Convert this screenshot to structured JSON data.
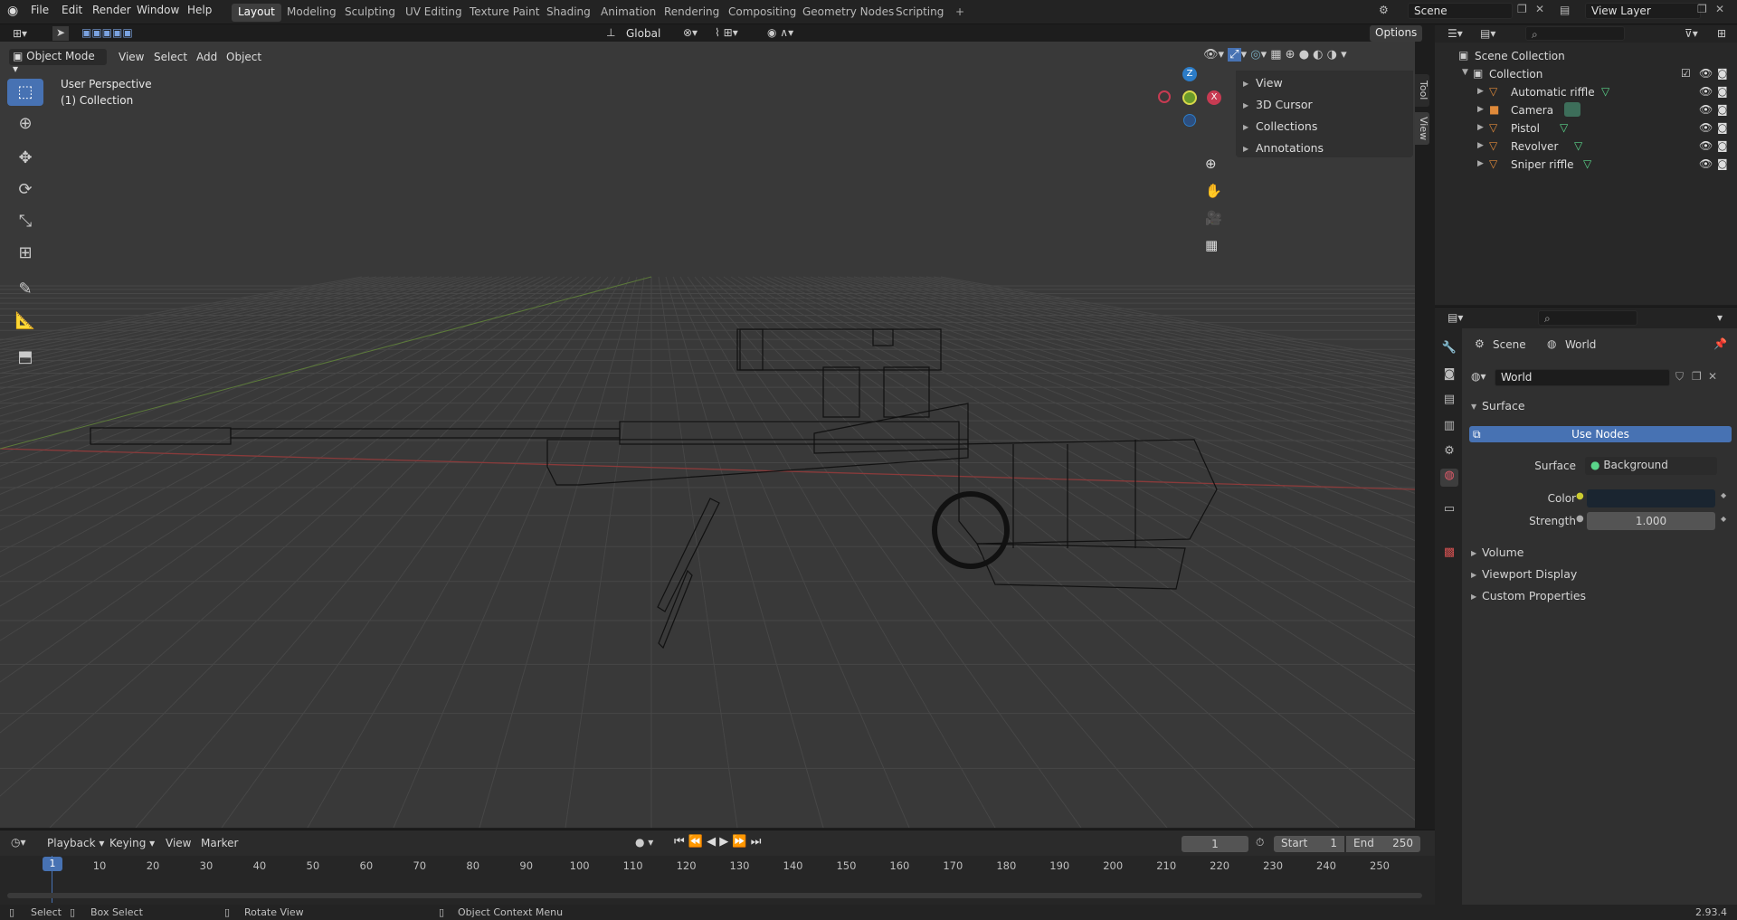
{
  "app": {
    "version": "2.93.4"
  },
  "topbar": {
    "menus": [
      "File",
      "Edit",
      "Render",
      "Window",
      "Help"
    ],
    "workspaces": [
      "Layout",
      "Modeling",
      "Sculpting",
      "UV Editing",
      "Texture Paint",
      "Shading",
      "Animation",
      "Rendering",
      "Compositing",
      "Geometry Nodes",
      "Scripting"
    ],
    "active_workspace": "Layout",
    "scene": "Scene",
    "view_layer": "View Layer"
  },
  "viewport_header": {
    "mode": "Object Mode",
    "menus": [
      "View",
      "Select",
      "Add",
      "Object"
    ],
    "orientation": "Global",
    "options": "Options"
  },
  "viewport": {
    "perspective": "User Perspective",
    "collection": "(1) Collection",
    "gizmo": {
      "z": "Z",
      "x": "X",
      "y": "Y"
    },
    "npanel": [
      "View",
      "3D Cursor",
      "Collections",
      "Annotations"
    ],
    "npanel_tabs": [
      "Tool",
      "View"
    ]
  },
  "outliner": {
    "root": "Scene Collection",
    "collection": "Collection",
    "items": [
      {
        "name": "Automatic riffle"
      },
      {
        "name": "Camera"
      },
      {
        "name": "Pistol"
      },
      {
        "name": "Revolver"
      },
      {
        "name": "Sniper riffle"
      }
    ]
  },
  "properties": {
    "breadcrumb_scene": "Scene",
    "breadcrumb_world": "World",
    "world_name": "World",
    "surface_section": "Surface",
    "use_nodes": "Use Nodes",
    "surface_label": "Surface",
    "surface_value": "Background",
    "color_label": "Color",
    "strength_label": "Strength",
    "strength_value": "1.000",
    "sections": [
      "Volume",
      "Viewport Display",
      "Custom Properties"
    ]
  },
  "timeline": {
    "menus": [
      "Playback",
      "Keying",
      "View",
      "Marker"
    ],
    "current_frame": "1",
    "start_label": "Start",
    "start_value": "1",
    "end_label": "End",
    "end_value": "250",
    "ticks": [
      "1",
      "10",
      "20",
      "30",
      "40",
      "50",
      "60",
      "70",
      "80",
      "90",
      "100",
      "110",
      "120",
      "130",
      "140",
      "150",
      "160",
      "170",
      "180",
      "190",
      "200",
      "210",
      "220",
      "230",
      "240",
      "250"
    ]
  },
  "statusbar": {
    "select": "Select",
    "box_select": "Box Select",
    "rotate": "Rotate View",
    "context": "Object Context Menu"
  }
}
